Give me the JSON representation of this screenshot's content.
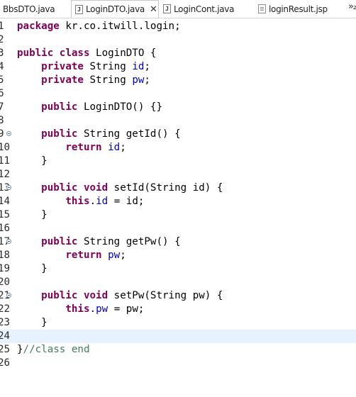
{
  "tabs": [
    {
      "label": "BbsDTO.java",
      "icon": "java-file-icon",
      "active": false
    },
    {
      "label": "LoginDTO.java",
      "icon": "java-file-icon",
      "active": true,
      "close": "✕"
    },
    {
      "label": "LoginCont.java",
      "icon": "java-file-icon",
      "active": false
    },
    {
      "label": "loginResult.jsp",
      "icon": "jsp-file-icon",
      "active": false
    }
  ],
  "overflow_label": "»₂",
  "editor": {
    "current_line": 24,
    "lines": [
      {
        "n": "1"
      },
      {
        "n": "2"
      },
      {
        "n": "3"
      },
      {
        "n": "4"
      },
      {
        "n": "5"
      },
      {
        "n": "6"
      },
      {
        "n": "7"
      },
      {
        "n": "8"
      },
      {
        "n": "9"
      },
      {
        "n": "10"
      },
      {
        "n": "11"
      },
      {
        "n": "12"
      },
      {
        "n": "13"
      },
      {
        "n": "14"
      },
      {
        "n": "15"
      },
      {
        "n": "16"
      },
      {
        "n": "17"
      },
      {
        "n": "18"
      },
      {
        "n": "19"
      },
      {
        "n": "20"
      },
      {
        "n": "21"
      },
      {
        "n": "22"
      },
      {
        "n": "23"
      },
      {
        "n": "24"
      },
      {
        "n": "25"
      },
      {
        "n": "26"
      }
    ],
    "code": {
      "l1": {
        "kw": "package",
        "rest": " kr.co.itwill.login;"
      },
      "l3": {
        "kw1": "public",
        "kw2": "class",
        "rest": " LoginDTO {"
      },
      "l4": {
        "kw": "private",
        "type": " String ",
        "field": "id",
        "end": ";"
      },
      "l5": {
        "kw": "private",
        "type": " String ",
        "field": "pw",
        "end": ";"
      },
      "l7": {
        "kw": "public",
        "rest": " LoginDTO() {}"
      },
      "l9": {
        "kw": "public",
        "rest": " String getId() {"
      },
      "l10": {
        "kw": "return",
        "field": "id",
        "end": ";"
      },
      "l11": {
        "text": "}"
      },
      "l13": {
        "kw1": "public",
        "kw2": "void",
        "rest": " setId(String id) {"
      },
      "l14": {
        "kw": "this",
        "dot": ".",
        "field": "id",
        "end": " = id;"
      },
      "l15": {
        "text": "}"
      },
      "l17": {
        "kw": "public",
        "rest": " String getPw() {"
      },
      "l18": {
        "kw": "return",
        "field": "pw",
        "end": ";"
      },
      "l19": {
        "text": "}"
      },
      "l21": {
        "kw1": "public",
        "kw2": "void",
        "rest": " setPw(String pw) {"
      },
      "l22": {
        "kw": "this",
        "dot": ".",
        "field": "pw",
        "end": " = pw;"
      },
      "l23": {
        "text": "}"
      },
      "l25": {
        "brace": "}",
        "comment": "//class end"
      }
    }
  },
  "colors": {
    "keyword": "#7f0055",
    "field": "#0000c0",
    "comment": "#3f7f5f",
    "current_line_bg": "#e8f2fe"
  }
}
